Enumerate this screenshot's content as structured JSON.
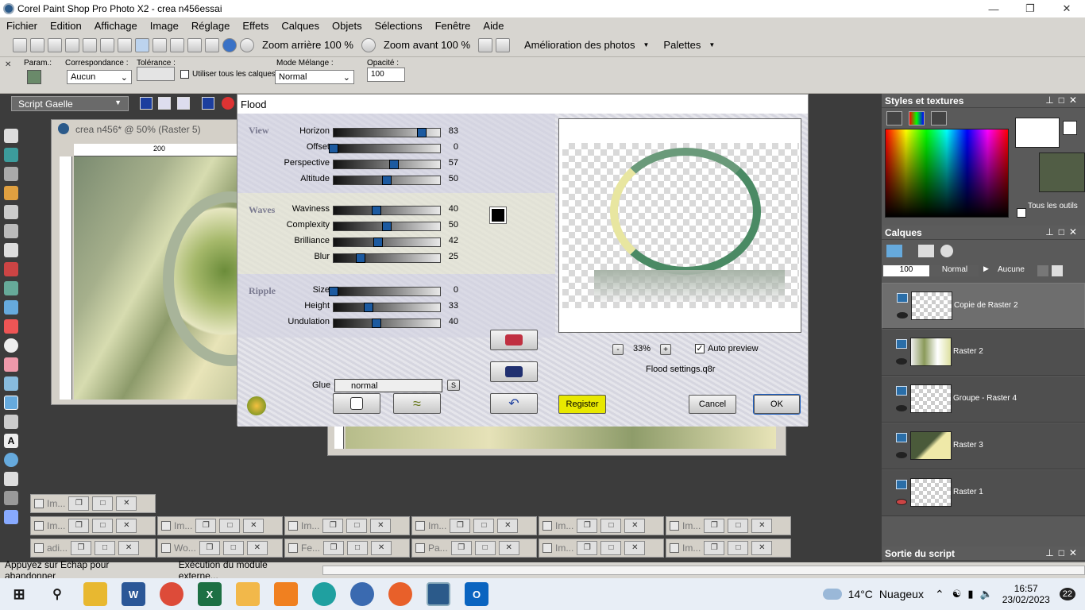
{
  "app": {
    "title": "Corel Paint Shop Pro Photo X2 - crea n456essai"
  },
  "menu": [
    "Fichier",
    "Edition",
    "Affichage",
    "Image",
    "Réglage",
    "Effets",
    "Calques",
    "Objets",
    "Sélections",
    "Fenêtre",
    "Aide"
  ],
  "toolbar": {
    "zoom_out": "Zoom arrière 100 %",
    "zoom_in": "Zoom avant 100 %",
    "photo_fix": "Amélioration des photos",
    "palettes": "Palettes"
  },
  "options": {
    "param_label": "Param.:",
    "match_label": "Correspondance :",
    "match_value": "Aucun",
    "tolerance_label": "Tolérance :",
    "all_layers_label": "Utiliser tous les calques",
    "blend_label": "Mode Mélange :",
    "blend_value": "Normal",
    "opacity_label": "Opacité :",
    "opacity_value": "100"
  },
  "script": {
    "selected": "Script Gaelle"
  },
  "doc": {
    "title": "crea n456* @  50% (Raster 5)",
    "ruler_200": "200"
  },
  "dialog": {
    "title": "Flood",
    "sections": {
      "view": "View",
      "waves": "Waves",
      "ripple": "Ripple"
    },
    "sliders": [
      {
        "label": "Horizon",
        "value": 83
      },
      {
        "label": "Offset",
        "value": 0
      },
      {
        "label": "Perspective",
        "value": 57
      },
      {
        "label": "Altitude",
        "value": 50
      },
      {
        "label": "Waviness",
        "value": 40
      },
      {
        "label": "Complexity",
        "value": 50
      },
      {
        "label": "Brilliance",
        "value": 42
      },
      {
        "label": "Blur",
        "value": 25
      },
      {
        "label": "Size",
        "value": 0
      },
      {
        "label": "Height",
        "value": 33
      },
      {
        "label": "Undulation",
        "value": 40
      }
    ],
    "glue_label": "Glue",
    "glue_value": "normal",
    "glue_btn": "S",
    "zoom_minus": "-",
    "zoom": "33%",
    "zoom_plus": "+",
    "auto_preview": "Auto preview",
    "settings_file": "Flood settings.q8r",
    "register": "Register",
    "cancel": "Cancel",
    "ok": "OK",
    "swatch_color": "#000000"
  },
  "panels": {
    "styles_title": "Styles et textures",
    "all_tools": "Tous les outils",
    "layers_title": "Calques",
    "layer_opacity": "100",
    "layer_blend": "Normal",
    "layer_mask": "Aucune",
    "layers": [
      "Copie de Raster 2",
      "Raster 2",
      "Groupe - Raster 4",
      "Raster 3",
      "Raster 1"
    ],
    "script_output_title": "Sortie du script"
  },
  "minimized": [
    {
      "label": "Im..."
    },
    {
      "label": "Im..."
    },
    {
      "label": "Im..."
    },
    {
      "label": "Im..."
    },
    {
      "label": "Im..."
    },
    {
      "label": "Im..."
    },
    {
      "label": "Im..."
    },
    {
      "label": "adi..."
    },
    {
      "label": "Wo..."
    },
    {
      "label": "Fe..."
    },
    {
      "label": "Pa..."
    },
    {
      "label": "Im..."
    },
    {
      "label": "Im..."
    }
  ],
  "status": {
    "hint": "Appuyez sur Echap pour abandonner",
    "progress": "Exécution du module externe..."
  },
  "taskbar": {
    "weather_temp": "14°C",
    "weather_desc": "Nuageux",
    "time": "16:57",
    "date": "23/02/2023",
    "notif": "22"
  }
}
